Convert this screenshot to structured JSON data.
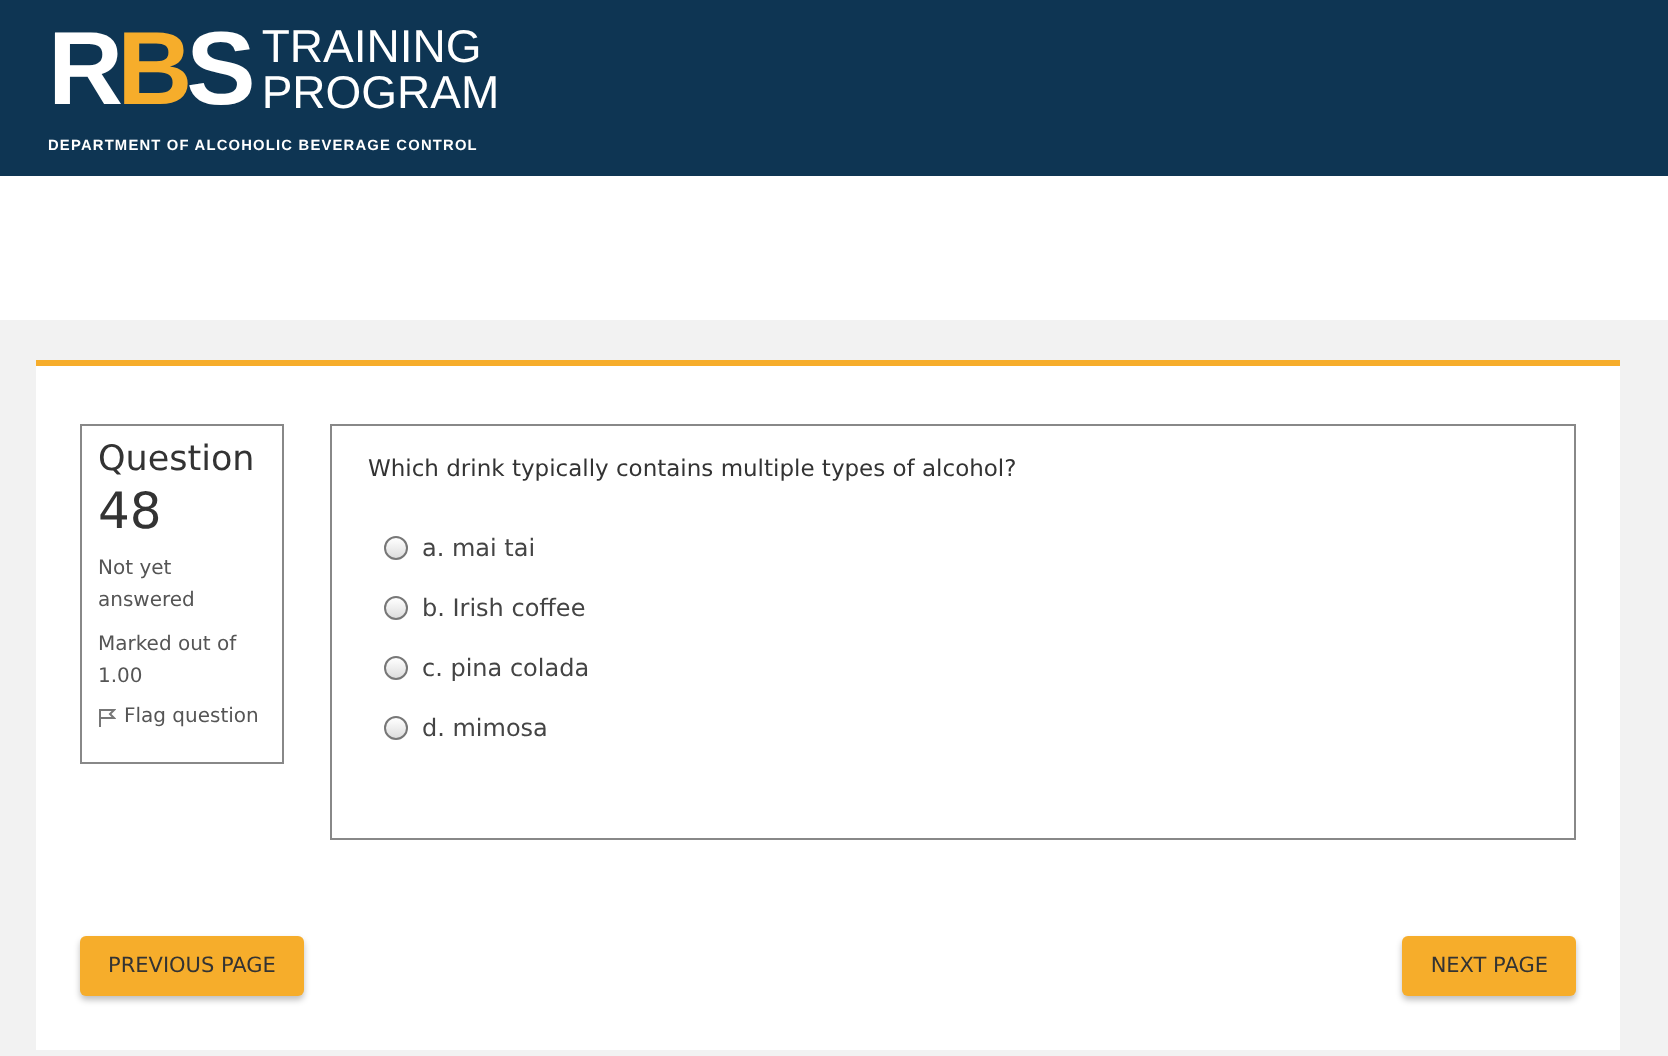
{
  "header": {
    "logo_letters": [
      {
        "text": "R",
        "color": "#ffffff"
      },
      {
        "text": "B",
        "color": "#f6ad2b"
      },
      {
        "text": "S",
        "color": "#ffffff"
      }
    ],
    "title_lines": [
      "TRAINING",
      "PROGRAM"
    ],
    "subtitle": "DEPARTMENT OF ALCOHOLIC BEVERAGE CONTROL"
  },
  "question_info": {
    "label": "Question",
    "number": "48",
    "status": "Not yet answered",
    "marks": "Marked out of 1.00",
    "flag": "Flag question"
  },
  "question": {
    "text": "Which drink typically contains multiple types of alcohol?",
    "options": [
      {
        "label": "a. mai tai",
        "selected": false
      },
      {
        "label": "b. Irish coffee",
        "selected": false
      },
      {
        "label": "c. pina colada",
        "selected": false
      },
      {
        "label": "d. mimosa",
        "selected": false
      }
    ]
  },
  "buttons": {
    "previous": "PREVIOUS PAGE",
    "next": "NEXT PAGE"
  }
}
